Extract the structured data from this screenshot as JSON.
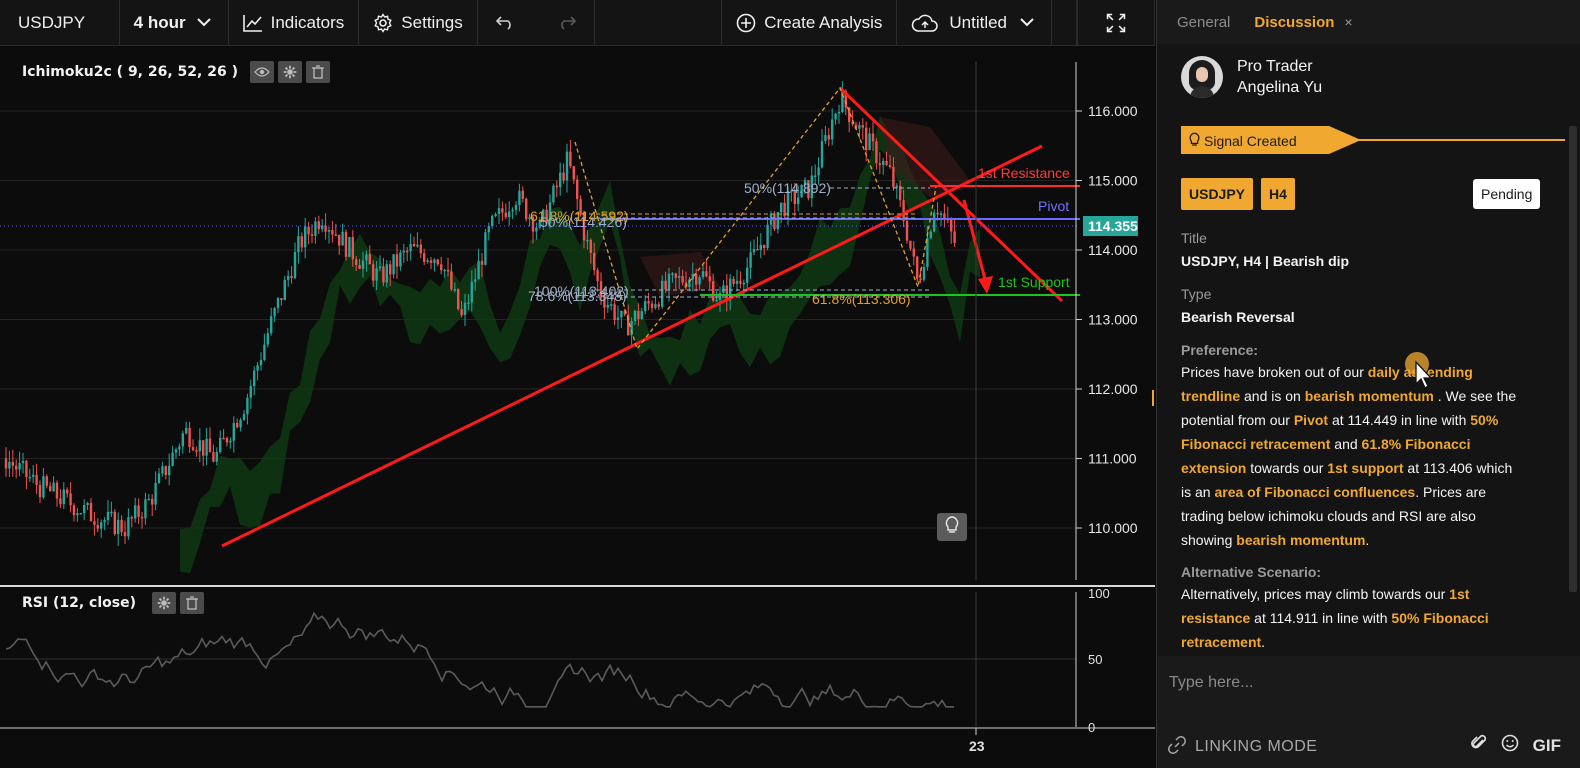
{
  "toolbar": {
    "symbol": "USDJPY",
    "interval": "4 hour",
    "indicators": "Indicators",
    "settings": "Settings",
    "create_analysis": "Create Analysis",
    "untitled": "Untitled"
  },
  "chart": {
    "indicator_label": "Ichimoku2c ( 9, 26, 52, 26 )",
    "rsi_label": "RSI (12, close)",
    "price_ticks": [
      "116.000",
      "115.000",
      "114.000",
      "113.000",
      "112.000",
      "111.000",
      "110.000"
    ],
    "current_price": "114.355",
    "rsi_ticks": [
      "100",
      "50",
      "0"
    ],
    "x_tick": "23",
    "annotations": {
      "resistance": "1st Resistance",
      "pivot": "Pivot",
      "support": "1st Support",
      "fib_50": "50%(114.892)",
      "fib_618_upper": "61.8%(114.592)",
      "fib_50_lower": "50%(114.426)",
      "fib_100": "100%(113.402)",
      "fib_786": "78.6%(113.348)",
      "fib_618_lower": "61.8%(113.306)"
    },
    "colors": {
      "up": "#26a69a",
      "down": "#ef5350",
      "trendline": "#ff1a1a",
      "pivot": "#6b6bff",
      "support": "#1ec31e",
      "fib": "#e0a030",
      "price_badge": "#26a69a"
    }
  },
  "panel": {
    "tabs": {
      "general": "General",
      "discussion": "Discussion",
      "close": "×"
    },
    "author": {
      "role": "Pro Trader",
      "name": "Angelina Yu"
    },
    "signal": "Signal Created",
    "tags": [
      "USDJPY",
      "H4"
    ],
    "status": "Pending",
    "title_label": "Title",
    "title_value": "USDJPY, H4 | Bearish dip",
    "type_label": "Type",
    "type_value": "Bearish Reversal",
    "pref_label": "Preference:",
    "pref": {
      "t1": "Prices have broken out of our ",
      "h1": "daily ascending trendline",
      "t2": " and is on ",
      "h2": "bearish momentum",
      "t3": " . We see the potential from our ",
      "h3": "Pivot",
      "t4": " at 114.449 in line with ",
      "h4": "50% Fibonacci retracement",
      "t5": " and ",
      "h5": "61.8% Fibonacci extension",
      "t6": " towards our ",
      "h6": "1st support",
      "t7": " at 113.406 which is an ",
      "h7": "area of Fibonacci confluences",
      "t8": ". Prices are trading below ichimoku clouds and RSI are also showing ",
      "h8": "bearish momentum",
      "t9": "."
    },
    "alt_label": "Alternative Scenario:",
    "alt": {
      "t1": "Alternatively, prices may climb towards our ",
      "h1": "1st resistance",
      "t2": " at 114.911 in line with ",
      "h2": "50% Fibonacci retracement",
      "t3": "."
    },
    "input_placeholder": "Type here...",
    "linking_mode": "LINKING MODE",
    "gif": "GIF"
  }
}
